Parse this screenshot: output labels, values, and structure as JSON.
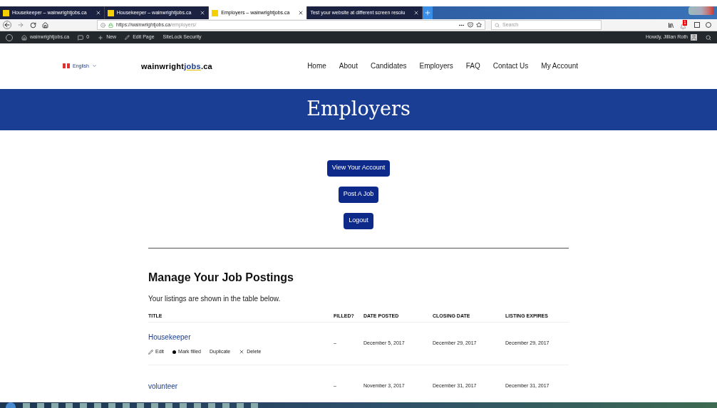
{
  "browser": {
    "tabs": [
      {
        "title": "Housekeeper – wainwrightjobs.ca",
        "selected": false
      },
      {
        "title": "Housekeeper – wainwrightjobs.ca",
        "selected": false
      },
      {
        "title": "Employers – wainwrightjobs.ca",
        "selected": true
      },
      {
        "title": "Test your website at different screen resolu",
        "selected": false
      }
    ],
    "url_host": "https://wainwrightjobs.ca",
    "url_path": "/employers/",
    "search": {
      "placeholder": "Search"
    },
    "notification_count": "1"
  },
  "admin_bar": {
    "site": "wainwrightjobs.ca",
    "comments": "0",
    "new": "New",
    "edit": "Edit Page",
    "security": "SiteLock Security",
    "greeting": "Howdy, Jillian Roth"
  },
  "header": {
    "language": "English",
    "logo": {
      "part1": "wainwright",
      "part2": "jobs",
      "part3": ".ca"
    },
    "nav": [
      "Home",
      "About",
      "Candidates",
      "Employers",
      "FAQ",
      "Contact Us",
      "My Account"
    ]
  },
  "banner": {
    "title": "Employers"
  },
  "buttons": [
    "View Your Account",
    "Post A Job",
    "Logout"
  ],
  "section": {
    "title": "Manage Your Job Postings",
    "intro": "Your listings are shown in the table below.",
    "columns": [
      "TITLE",
      "FILLED?",
      "DATE POSTED",
      "CLOSING DATE",
      "LISTING EXPIRES"
    ],
    "rows": [
      {
        "title": "Housekeeper",
        "filled": "–",
        "posted": "December 5, 2017",
        "closing": "December 29, 2017",
        "expires": "December 29, 2017",
        "actions": [
          "Edit",
          "Mark filled",
          "Duplicate",
          "Delete"
        ]
      },
      {
        "title": "volunteer",
        "filled": "–",
        "posted": "November 3, 2017",
        "closing": "December 31, 2017",
        "expires": "December 31, 2017",
        "actions": []
      }
    ]
  }
}
